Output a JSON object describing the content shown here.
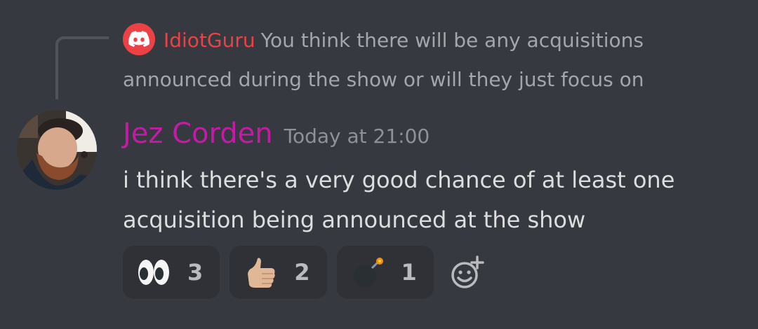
{
  "reply": {
    "author": "IdiotGuru",
    "text": "You think there will be any acquisitions announced during the show or will they just focus on",
    "author_color": "#ed4245"
  },
  "message": {
    "author": "Jez Corden",
    "author_color": "#c41ba6",
    "timestamp": "Today at 21:00",
    "content": "i think there's a very good chance of at least one acquisition being announced at the show"
  },
  "reactions": [
    {
      "emoji": "eyes-emoji",
      "count": "3"
    },
    {
      "emoji": "thumbs-up-emoji",
      "count": "2"
    },
    {
      "emoji": "bomb-emoji",
      "count": "1"
    }
  ],
  "add_reaction_icon": "add-reaction-icon",
  "colors": {
    "background": "#36393f",
    "reaction_bg": "#2f3136",
    "text": "#dcddde",
    "muted": "#a3a6aa"
  }
}
